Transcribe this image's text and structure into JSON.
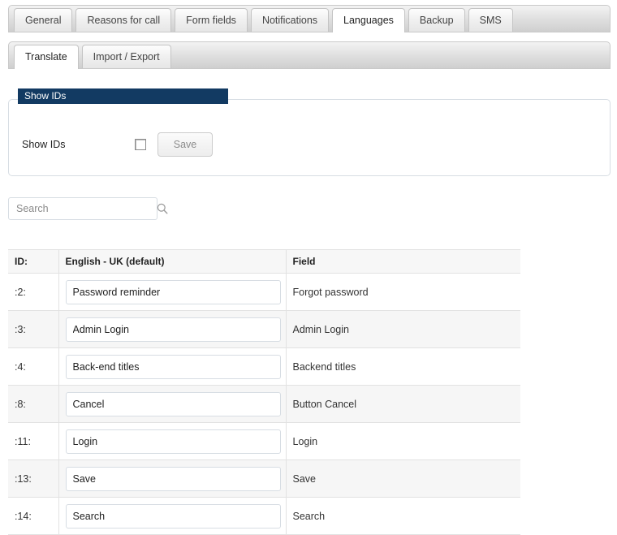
{
  "primary_tabs": [
    {
      "label": "General",
      "active": false
    },
    {
      "label": "Reasons for call",
      "active": false
    },
    {
      "label": "Form fields",
      "active": false
    },
    {
      "label": "Notifications",
      "active": false
    },
    {
      "label": "Languages",
      "active": true
    },
    {
      "label": "Backup",
      "active": false
    },
    {
      "label": "SMS",
      "active": false
    }
  ],
  "secondary_tabs": [
    {
      "label": "Translate",
      "active": true
    },
    {
      "label": "Import / Export",
      "active": false
    }
  ],
  "panel": {
    "legend": "Show IDs",
    "label": "Show IDs",
    "checked": false,
    "save_label": "Save",
    "legend_color": "#123A62"
  },
  "search": {
    "value": "",
    "placeholder": "Search",
    "icon": "search-icon"
  },
  "table": {
    "headers": [
      "ID:",
      "English - UK (default)",
      "Field"
    ],
    "rows": [
      {
        "id": ":2:",
        "translation": "Password reminder",
        "field": "Forgot password"
      },
      {
        "id": ":3:",
        "translation": "Admin Login",
        "field": "Admin Login"
      },
      {
        "id": ":4:",
        "translation": "Back-end titles",
        "field": "Backend titles"
      },
      {
        "id": ":8:",
        "translation": "Cancel",
        "field": "Button Cancel"
      },
      {
        "id": ":11:",
        "translation": "Login",
        "field": "Login"
      },
      {
        "id": ":13:",
        "translation": "Save",
        "field": "Save"
      },
      {
        "id": ":14:",
        "translation": "Search",
        "field": "Search"
      }
    ]
  }
}
